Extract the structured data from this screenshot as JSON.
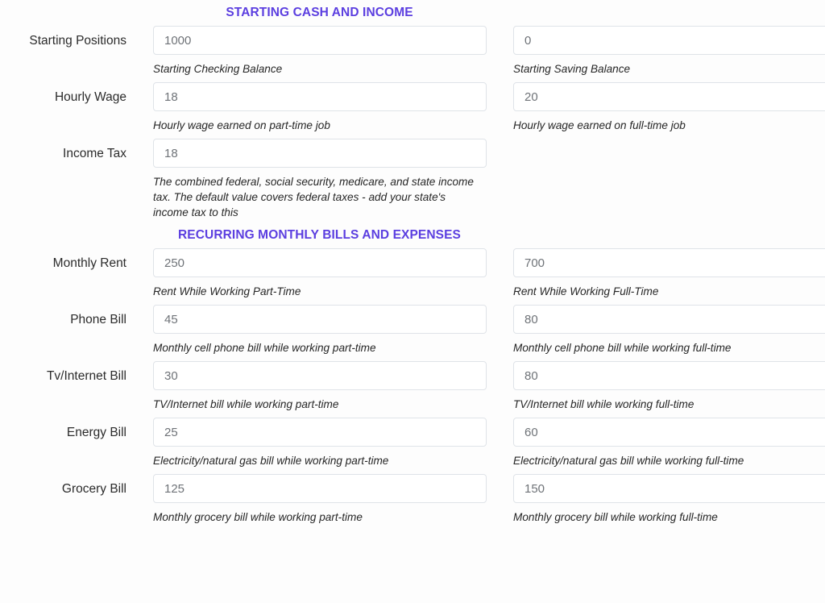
{
  "theme": {
    "accent": "#5b3ee0",
    "page_background": "#fdfdfd",
    "input_border": "#dfe3e8",
    "input_text": "#6f7378",
    "label_text": "#2b2b2b",
    "help_text": "#262626"
  },
  "sections": [
    {
      "id": "starting-cash-and-income",
      "title": "STARTING CASH AND INCOME",
      "rows": [
        {
          "label": "Starting Positions",
          "left": {
            "value": "1000",
            "help": "Starting Checking Balance"
          },
          "right": {
            "value": "0",
            "help": "Starting Saving Balance"
          }
        },
        {
          "label": "Hourly Wage",
          "left": {
            "value": "18",
            "help": "Hourly wage earned on part-time job"
          },
          "right": {
            "value": "20",
            "help": "Hourly wage earned on full-time job"
          }
        },
        {
          "label": "Income Tax",
          "left": {
            "value": "18",
            "help": "The combined federal, social security, medicare, and state income tax. The default value covers federal taxes - add your state's income tax to this"
          },
          "right": {
            "value": "",
            "help": ""
          }
        }
      ]
    },
    {
      "id": "recurring-monthly-bills-and-expenses",
      "title": "RECURRING MONTHLY BILLS AND EXPENSES",
      "rows": [
        {
          "label": "Monthly Rent",
          "left": {
            "value": "250",
            "help": "Rent While Working Part-Time"
          },
          "right": {
            "value": "700",
            "help": "Rent While Working Full-Time"
          }
        },
        {
          "label": "Phone Bill",
          "left": {
            "value": "45",
            "help": "Monthly cell phone bill while working part-time"
          },
          "right": {
            "value": "80",
            "help": "Monthly cell phone bill while working full-time"
          }
        },
        {
          "label": "Tv/Internet Bill",
          "left": {
            "value": "30",
            "help": "TV/Internet bill while working part-time"
          },
          "right": {
            "value": "80",
            "help": "TV/Internet bill while working full-time"
          }
        },
        {
          "label": "Energy Bill",
          "left": {
            "value": "25",
            "help": "Electricity/natural gas bill while working part-time"
          },
          "right": {
            "value": "60",
            "help": "Electricity/natural gas bill while working full-time"
          }
        },
        {
          "label": "Grocery Bill",
          "left": {
            "value": "125",
            "help": "Monthly grocery bill while working part-time"
          },
          "right": {
            "value": "150",
            "help": "Monthly grocery bill while working full-time"
          }
        }
      ]
    }
  ]
}
